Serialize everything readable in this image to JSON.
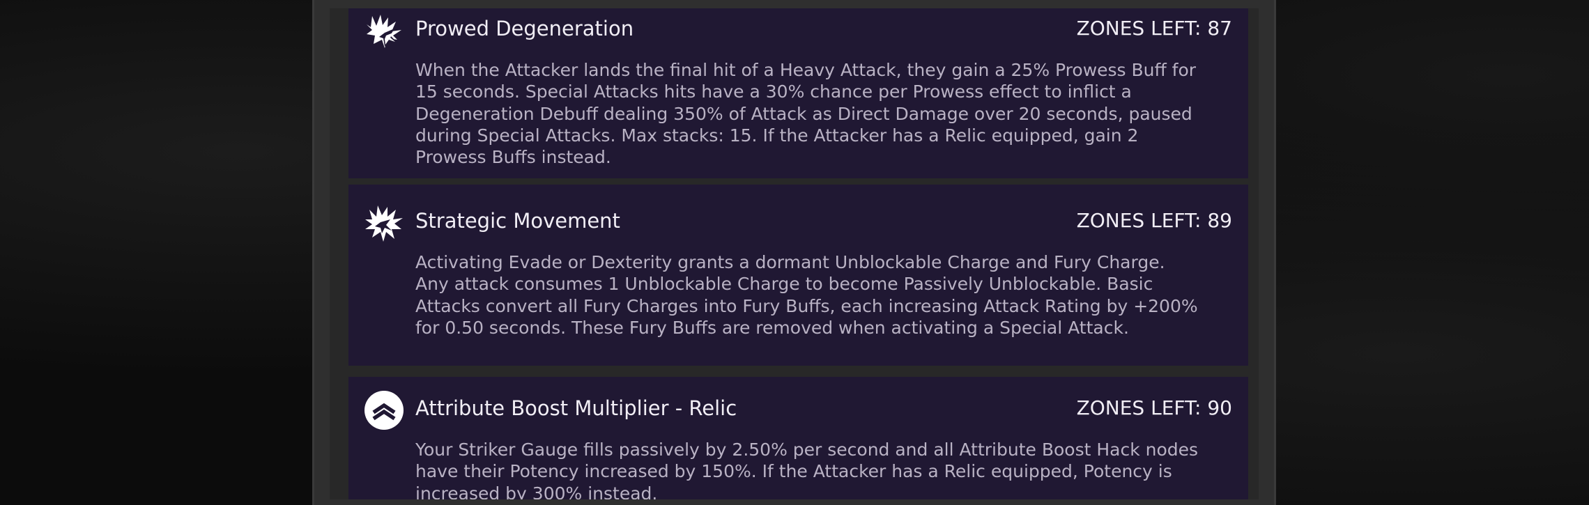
{
  "nodes": [
    {
      "icon": "prowess-burst-icon",
      "title": "Prowed Degeneration",
      "zones_left": "ZONES LEFT: 87",
      "description": "When the Attacker lands the final hit of a Heavy Attack, they gain a 25% Prowess Buff for 15 seconds. Special Attacks hits have a 30% chance per Prowess effect to inflict a Degeneration Debuff dealing 350% of Attack as Direct Damage over 20 seconds, paused during Special Attacks. Max stacks: 15. If the Attacker has a Relic equipped, gain 2 Prowess Buffs instead."
    },
    {
      "icon": "fury-burst-icon",
      "title": "Strategic Movement",
      "zones_left": "ZONES LEFT: 89",
      "description": "Activating Evade or Dexterity grants a dormant Unblockable Charge and Fury Charge. Any attack consumes 1 Unblockable Charge to become Passively Unblockable. Basic Attacks convert all Fury Charges into Fury Buffs, each increasing Attack Rating by +200% for 0.50 seconds. These Fury Buffs are removed when activating a Special Attack."
    },
    {
      "icon": "attribute-boost-chevron-icon",
      "title": "Attribute Boost Multiplier - Relic",
      "zones_left": "ZONES LEFT: 90",
      "description": "Your Striker Gauge fills passively by 2.50% per second and all Attribute Boost Hack nodes have their Potency increased by 150%. If the Attacker has a Relic equipped, Potency is increased by 300% instead."
    }
  ]
}
